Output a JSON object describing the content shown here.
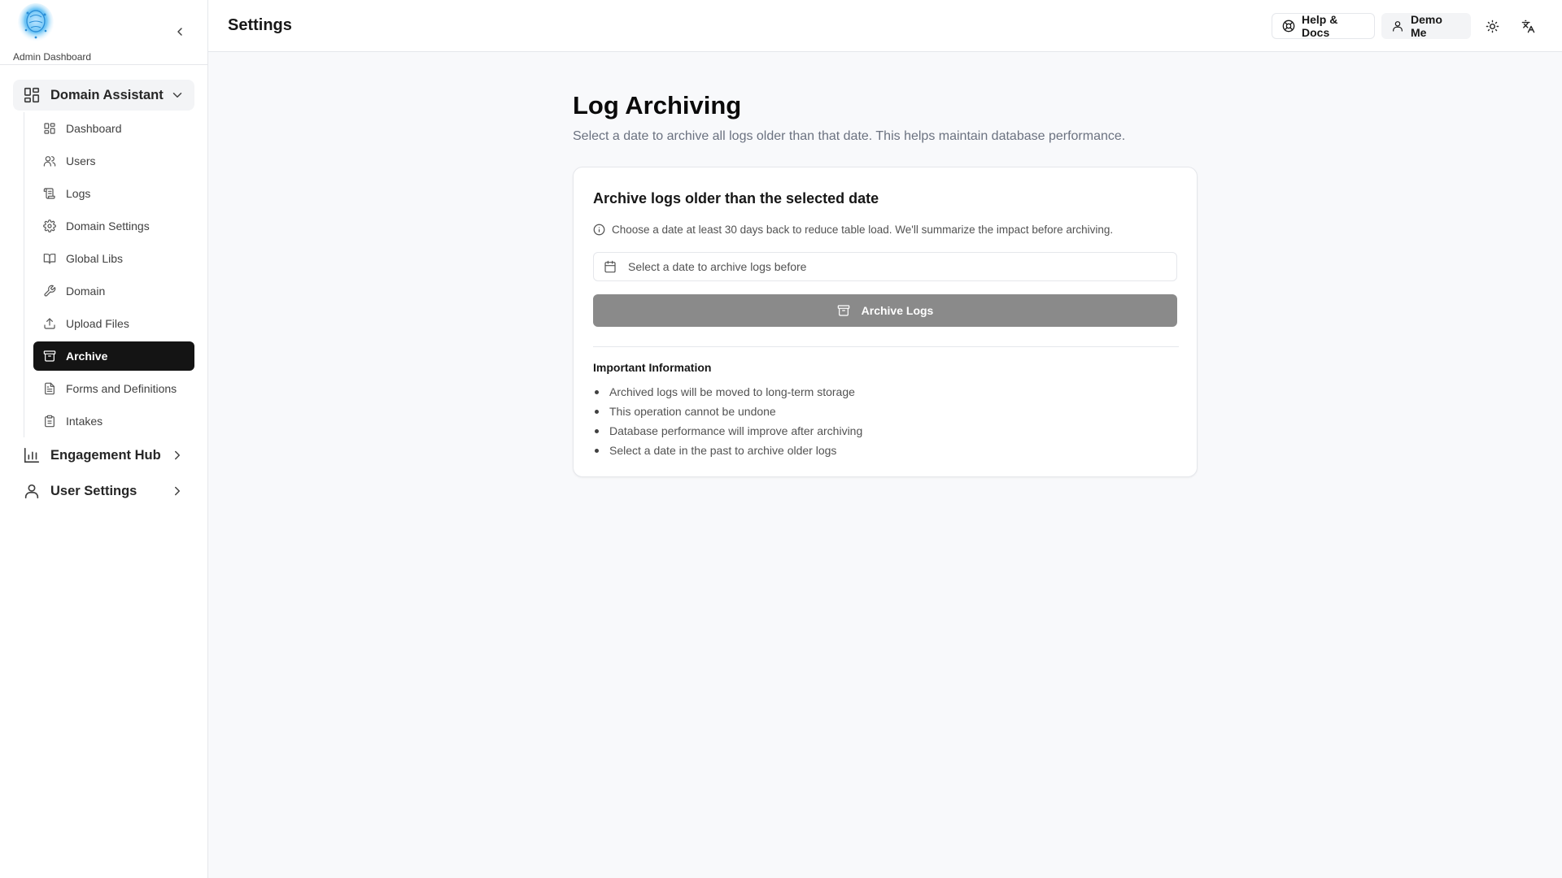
{
  "sidebar": {
    "brand_text": "Admin Dashboard",
    "groups": [
      {
        "label": "Domain Assistant",
        "icon": "layout-grid-icon",
        "expanded": true
      },
      {
        "label": "Engagement Hub",
        "icon": "bar-chart-icon",
        "expanded": false
      },
      {
        "label": "User Settings",
        "icon": "user-icon",
        "expanded": false
      }
    ],
    "items": [
      {
        "label": "Dashboard",
        "icon": "layout-grid-icon"
      },
      {
        "label": "Users",
        "icon": "users-icon"
      },
      {
        "label": "Logs",
        "icon": "scroll-icon"
      },
      {
        "label": "Domain Settings",
        "icon": "gear-icon"
      },
      {
        "label": "Global Libs",
        "icon": "book-icon"
      },
      {
        "label": "Domain",
        "icon": "wrench-icon"
      },
      {
        "label": "Upload Files",
        "icon": "upload-icon"
      },
      {
        "label": "Archive",
        "icon": "archive-icon",
        "active": true
      },
      {
        "label": "Forms and Definitions",
        "icon": "file-text-icon"
      },
      {
        "label": "Intakes",
        "icon": "clipboard-icon"
      }
    ]
  },
  "header": {
    "title": "Settings",
    "help_label": "Help & Docs",
    "user_label": "Demo Me"
  },
  "main": {
    "title": "Log Archiving",
    "subtitle": "Select a date to archive all logs older than that date. This helps maintain database performance.",
    "card": {
      "title": "Archive logs older than the selected date",
      "hint": "Choose a date at least 30 days back to reduce table load. We'll summarize the impact before archiving.",
      "date_placeholder": "Select a date to archive logs before",
      "button_label": "Archive Logs",
      "info_title": "Important Information",
      "info_items": [
        "Archived logs will be moved to long-term storage",
        "This operation cannot be undone",
        "Database performance will improve after archiving",
        "Select a date in the past to archive older logs"
      ]
    }
  },
  "colors": {
    "active_nav_bg": "#141414",
    "button_disabled_bg": "#8a8a8a",
    "page_bg": "#f8f9fb"
  }
}
